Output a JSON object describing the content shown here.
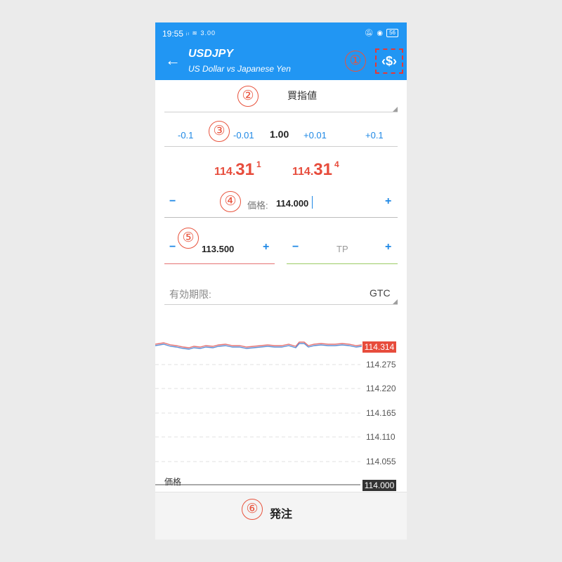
{
  "status_bar": {
    "time": "19:55",
    "signal": "ᵢₗ ≋ 3.00",
    "battery": "56"
  },
  "header": {
    "symbol": "USDJPY",
    "description": "US Dollar vs Japanese Yen",
    "back_icon": "arrow-left-icon",
    "action_icon": "dollar-exchange-icon",
    "color": "#2196f3"
  },
  "annotations": [
    "①",
    "②",
    "③",
    "④",
    "⑤",
    "⑥"
  ],
  "order_type": "買指値",
  "volume": {
    "steps": [
      "-0.1",
      "-0.01",
      "+0.01",
      "+0.1"
    ],
    "value": "1.00"
  },
  "quotes": {
    "bid": {
      "prefix": "114.",
      "main": "31",
      "sup": "1"
    },
    "ask": {
      "prefix": "114.",
      "main": "31",
      "sup": "4"
    },
    "color": "#e74c3c"
  },
  "price_field": {
    "label": "価格:",
    "value": "114.000",
    "minus": "−",
    "plus": "+"
  },
  "sl_field": {
    "value": "113.500",
    "minus": "−",
    "plus": "+",
    "underline_color": "#e57373"
  },
  "tp_field": {
    "placeholder": "TP",
    "minus": "−",
    "plus": "+",
    "underline_color": "#9ccc65"
  },
  "expiration": {
    "label": "有効期限:",
    "value": "GTC"
  },
  "chart": {
    "current_price": "114.314",
    "ticks": [
      "114.275",
      "114.220",
      "114.165",
      "114.110",
      "114.055"
    ],
    "price_label": "価格",
    "level_price": "114.000"
  },
  "footer": {
    "order_label": "発注"
  }
}
